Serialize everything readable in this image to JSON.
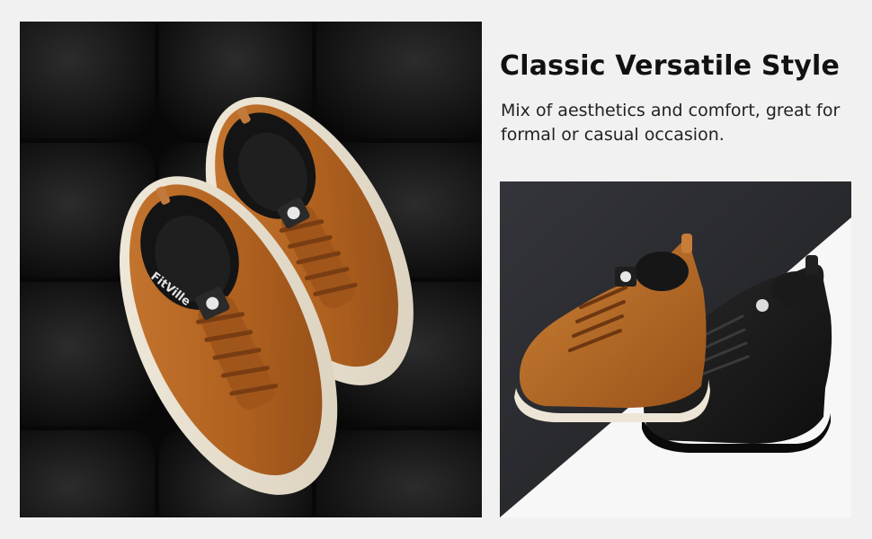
{
  "headline": "Classic Versatile Style",
  "description": "Mix of aesthetics and comfort, great for formal or casual occasion.",
  "brand": {
    "wordmark": "FitVille"
  },
  "colors": {
    "page_background": "#f1f1f1",
    "leather_brown": "#b5651d",
    "leather_black": "#161616",
    "sole_cream": "#ece4d4",
    "backdrop_dark": "#0c0c0c"
  },
  "images": {
    "main_photo": "top-down-brown-sneakers-on-black-leather",
    "side_photo": "brown-and-black-sneakers-side-view"
  }
}
